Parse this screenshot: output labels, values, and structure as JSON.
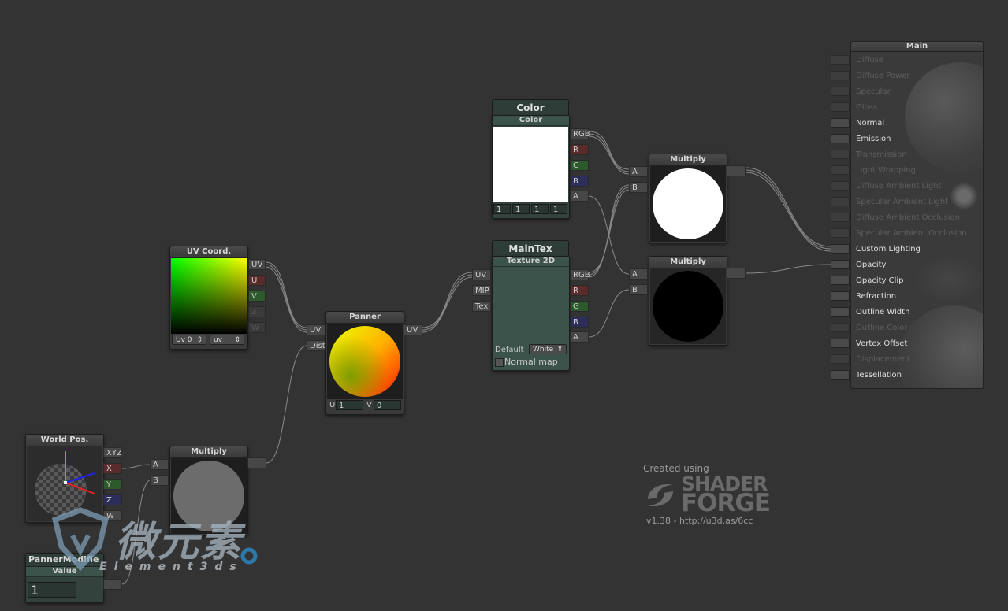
{
  "colors": {
    "canvas": "#333333",
    "node": "#3a3a3a",
    "property_header": "#3b534b",
    "wire": "#8a8a8a",
    "port_r": "#5a2b2b",
    "port_g": "#2d5a2d",
    "port_b": "#2d2d5a"
  },
  "uv_coord": {
    "title": "UV Coord.",
    "outputs": [
      "UV",
      "U",
      "V",
      "Z",
      "W"
    ],
    "channel_select": "Uv 0",
    "type_select": "uv"
  },
  "panner": {
    "title": "Panner",
    "inputs": [
      "UV",
      "Dist"
    ],
    "output": "UV",
    "u_label": "U",
    "u_value": "1",
    "v_label": "V",
    "v_value": "0"
  },
  "world_pos": {
    "title": "World Pos.",
    "outputs": [
      "XYZ",
      "X",
      "Y",
      "Z",
      "W"
    ]
  },
  "multiply_small": {
    "title": "Multiply",
    "inputs": [
      "A",
      "B"
    ]
  },
  "panner_modifier": {
    "title": "PannerModifie",
    "subtitle": "Value",
    "value": "1"
  },
  "color_node": {
    "title": "Color",
    "subtitle": "Color",
    "outputs": [
      "RGB",
      "R",
      "G",
      "B",
      "A"
    ],
    "values": [
      "1",
      "1",
      "1",
      "1"
    ],
    "swatch": "#ffffff"
  },
  "maintex": {
    "title": "MainTex",
    "subtitle": "Texture 2D",
    "inputs": [
      "UV",
      "MIP",
      "Tex"
    ],
    "outputs": [
      "RGB",
      "R",
      "G",
      "B",
      "A"
    ],
    "default_label": "Default",
    "default_value": "White",
    "normal_map_label": "Normal map"
  },
  "multiply_top": {
    "title": "Multiply",
    "inputs": [
      "A",
      "B"
    ]
  },
  "multiply_bottom": {
    "title": "Multiply",
    "inputs": [
      "A",
      "B"
    ]
  },
  "main": {
    "title": "Main",
    "rows": [
      {
        "label": "Diffuse",
        "active": false
      },
      {
        "label": "Diffuse Power",
        "active": false
      },
      {
        "label": "Specular",
        "active": false
      },
      {
        "label": "Gloss",
        "active": false
      },
      {
        "label": "Normal",
        "active": true
      },
      {
        "label": "Emission",
        "active": true
      },
      {
        "label": "Transmission",
        "active": false
      },
      {
        "label": "Light Wrapping",
        "active": false
      },
      {
        "label": "Diffuse Ambient Light",
        "active": false
      },
      {
        "label": "Specular Ambient Light",
        "active": false
      },
      {
        "label": "Diffuse Ambient Occlusion",
        "active": false
      },
      {
        "label": "Specular Ambient Occlusion",
        "active": false
      },
      {
        "label": "Custom Lighting",
        "active": true
      },
      {
        "label": "Opacity",
        "active": true
      },
      {
        "label": "Opacity Clip",
        "active": true
      },
      {
        "label": "Refraction",
        "active": true
      },
      {
        "label": "Outline Width",
        "active": true
      },
      {
        "label": "Outline Color",
        "active": false
      },
      {
        "label": "Vertex Offset",
        "active": true
      },
      {
        "label": "Displacement",
        "active": false
      },
      {
        "label": "Tessellation",
        "active": true
      }
    ]
  },
  "credits": {
    "created_using": "Created using",
    "logo_line1": "SHADER",
    "logo_line2": "FORGE",
    "version": "v1.38 - http://u3d.as/6cc"
  },
  "watermark": {
    "brand": "微元素",
    "sub": "Element3ds"
  }
}
